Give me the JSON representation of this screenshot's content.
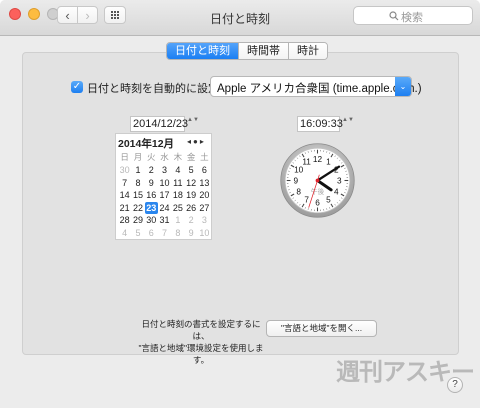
{
  "window": {
    "title": "日付と時刻"
  },
  "toolbar": {
    "back": "‹",
    "forward": "›"
  },
  "search": {
    "placeholder": "検索"
  },
  "tabs": [
    {
      "label": "日付と時刻",
      "active": true
    },
    {
      "label": "時間帯",
      "active": false
    },
    {
      "label": "時計",
      "active": false
    }
  ],
  "auto_set": {
    "checked": true,
    "checkmark": "✓",
    "label": "日付と時刻を自動的に設定："
  },
  "server": {
    "value": "Apple アメリカ合衆国 (time.apple.com.)",
    "arrow": "⌄"
  },
  "date_field": {
    "value": "2014/12/23",
    "stepper": "▲▼"
  },
  "time_field": {
    "value": "16:09:33",
    "stepper": "▲▼"
  },
  "calendar": {
    "month_label": "2014年12月",
    "nav": "◂●▸",
    "weekdays": [
      "日",
      "月",
      "火",
      "水",
      "木",
      "金",
      "土"
    ],
    "days": [
      "30",
      "1",
      "2",
      "3",
      "4",
      "5",
      "6",
      "7",
      "8",
      "9",
      "10",
      "11",
      "12",
      "13",
      "14",
      "15",
      "16",
      "17",
      "18",
      "19",
      "20",
      "21",
      "22",
      "23",
      "24",
      "25",
      "26",
      "27",
      "28",
      "29",
      "30",
      "31",
      "1",
      "2",
      "3",
      "4",
      "5",
      "6",
      "7",
      "8",
      "9",
      "10"
    ],
    "selected": "23"
  },
  "clock": {
    "ampm_label": "午後",
    "numbers": [
      "12",
      "1",
      "2",
      "3",
      "4",
      "5",
      "6",
      "7",
      "8",
      "9",
      "10",
      "11"
    ],
    "hours": 16,
    "minutes": 9,
    "seconds": 33
  },
  "region_note": {
    "line1": "日付と時刻の書式を設定するには、",
    "line2": "\"言語と地域\"環境設定を使用します。"
  },
  "region_button": {
    "label": "\"言語と地域\"を開く..."
  },
  "watermark": "週刊アスキー",
  "help": {
    "label": "?"
  },
  "colors": {
    "accent": "#1d7ff1",
    "second_hand": "#e0202a",
    "selected_day": "#2a86ee"
  }
}
